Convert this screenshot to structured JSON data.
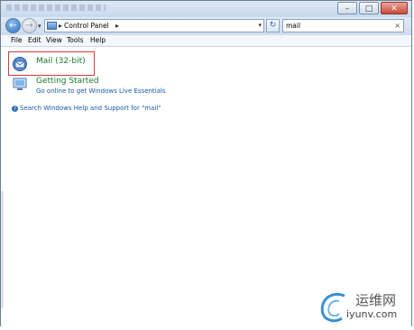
{
  "window": {
    "controls": [
      "–",
      "□",
      "✕"
    ]
  },
  "navigation": {
    "back_icon": "←",
    "forward_icon": "→",
    "recent_icon": "▾",
    "address": {
      "breadcrumb_sep": "▸",
      "location": "Control Panel",
      "trailing_sep": "▸",
      "dropdown_icon": "▾"
    },
    "refresh_icon": "↻",
    "search": {
      "value": "mail",
      "clear_icon": "×"
    }
  },
  "menu": {
    "items": [
      "File",
      "Edit",
      "View",
      "Tools",
      "Help"
    ]
  },
  "results": [
    {
      "title": "Mail (32-bit)",
      "subtitle": "",
      "icon": "mail-icon"
    },
    {
      "title": "Getting Started",
      "subtitle": "Go online to get Windows Live Essentials",
      "icon": "getting-started-icon"
    }
  ],
  "help_link": "Search Windows Help and Support for \"mail\"",
  "watermark": {
    "chinese": "运维网",
    "domain": "iyunv.com"
  },
  "colors": {
    "result_title": "#1a7a2e",
    "link": "#1557b0",
    "highlight_border": "#d43a3a"
  }
}
